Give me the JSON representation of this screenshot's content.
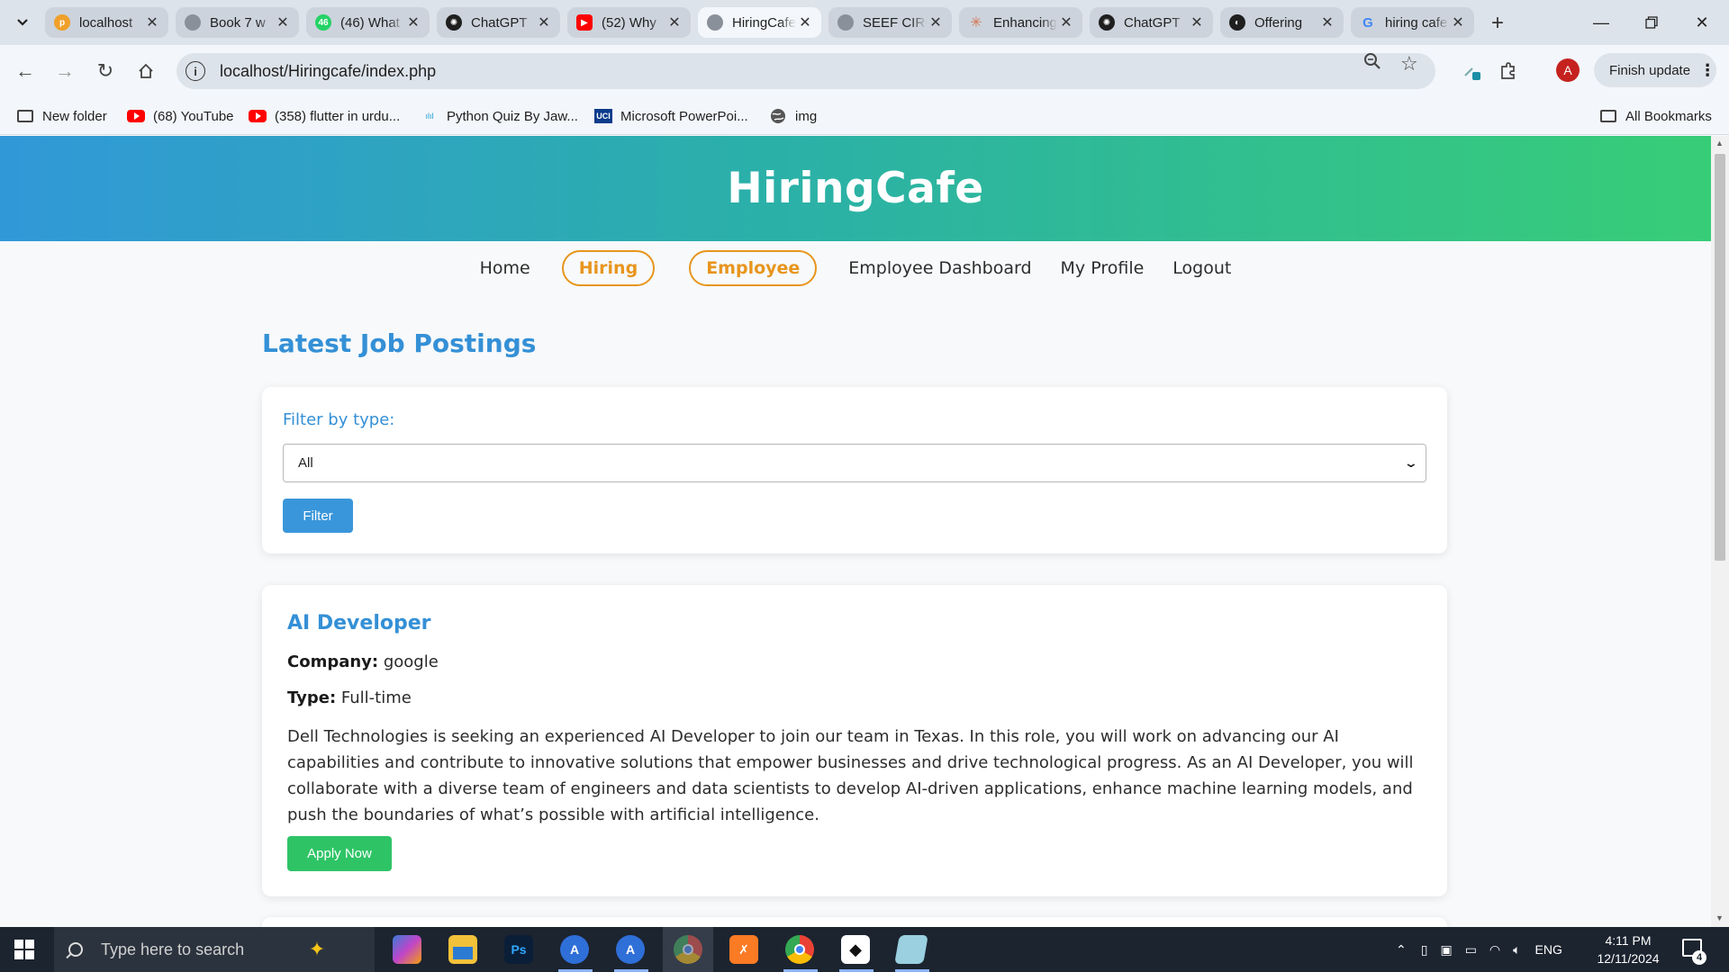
{
  "browser": {
    "tabs": [
      {
        "title": "localhost",
        "favicon": "phpmyadmin-icon",
        "color": "#f0a02a",
        "active": false
      },
      {
        "title": "Book 7 w",
        "favicon": "globe-icon",
        "color": "#7a7f86",
        "active": false
      },
      {
        "title": "(46) What",
        "favicon": "whatsapp-icon",
        "color": "#25d366",
        "active": false
      },
      {
        "title": "ChatGPT",
        "favicon": "chatgpt-icon",
        "color": "#1f1f1f",
        "active": false
      },
      {
        "title": "(52) Why",
        "favicon": "youtube-icon",
        "color": "#ff0000",
        "active": false
      },
      {
        "title": "HiringCafe",
        "favicon": "globe-icon",
        "color": "#7a7f86",
        "active": true
      },
      {
        "title": "SEEF CIRC",
        "favicon": "globe-icon",
        "color": "#7a7f86",
        "active": false
      },
      {
        "title": "Enhancing",
        "favicon": "claude-icon",
        "color": "#d97757",
        "active": false
      },
      {
        "title": "ChatGPT",
        "favicon": "chatgpt-icon",
        "color": "#1f1f1f",
        "active": false
      },
      {
        "title": "Offering",
        "favicon": "circle-icon",
        "color": "#1f1f1f",
        "active": false
      },
      {
        "title": "hiring cafe",
        "favicon": "google-icon",
        "color": "#4285f4",
        "active": false
      }
    ],
    "url": "localhost/Hiringcafe/index.php",
    "finish_update": "Finish update",
    "avatar_initial": "A",
    "bookmarks": [
      {
        "label": "New folder",
        "icon": "folder-icon"
      },
      {
        "label": "(68) YouTube",
        "icon": "youtube-icon"
      },
      {
        "label": "(358) flutter in urdu...",
        "icon": "youtube-icon"
      },
      {
        "label": "Python Quiz By Jaw...",
        "icon": "cisco-icon"
      },
      {
        "label": "Microsoft PowerPoi...",
        "icon": "uci-icon"
      },
      {
        "label": "img",
        "icon": "globe-icon"
      }
    ],
    "all_bookmarks": "All Bookmarks"
  },
  "site": {
    "title": "HiringCafe",
    "nav": {
      "home": "Home",
      "hiring": "Hiring",
      "employee": "Employee",
      "dashboard": "Employee Dashboard",
      "profile": "My Profile",
      "logout": "Logout"
    },
    "section_title": "Latest Job Postings",
    "filter": {
      "label": "Filter by type:",
      "selected": "All",
      "button": "Filter"
    },
    "jobs": [
      {
        "title": "AI Developer",
        "company_label": "Company:",
        "company": "google",
        "type_label": "Type:",
        "type": "Full-time",
        "description": "Dell Technologies is seeking an experienced AI Developer to join our team in Texas. In this role, you will work on advancing our AI capabilities and contribute to innovative solutions that empower businesses and drive technological progress. As an AI Developer, you will collaborate with a diverse team of engineers and data scientists to develop AI-driven applications, enhance machine learning models, and push the boundaries of what’s possible with artificial intelligence.",
        "apply": "Apply Now"
      }
    ],
    "colors": {
      "accent_blue": "#3490d6",
      "accent_orange": "#e8951d",
      "apply_green": "#2ec466",
      "header_gradient_start": "#3198d8",
      "header_gradient_end": "#37cd77"
    }
  },
  "taskbar": {
    "search_placeholder": "Type here to search",
    "language": "ENG",
    "time": "4:11 PM",
    "date": "12/11/2024",
    "notifications": "4"
  }
}
